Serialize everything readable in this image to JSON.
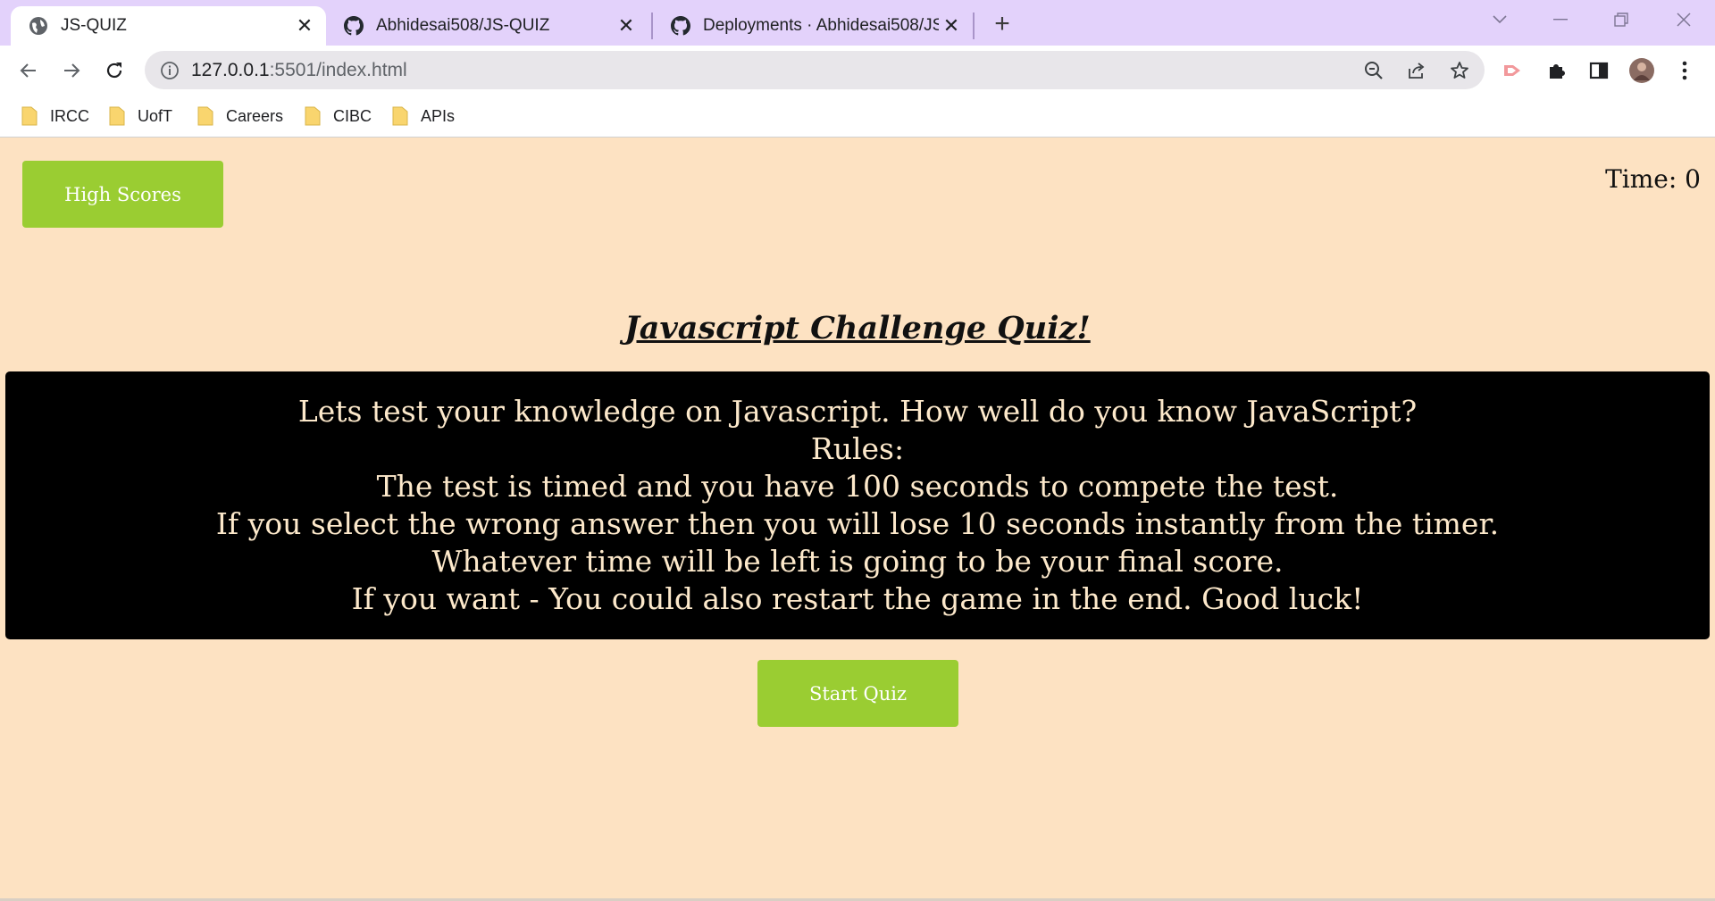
{
  "browser": {
    "tabs": [
      {
        "title": "JS-QUIZ",
        "active": true,
        "icon": "globe-icon"
      },
      {
        "title": "Abhidesai508/JS-QUIZ",
        "active": false,
        "icon": "github-icon"
      },
      {
        "title": "Deployments · Abhidesai508/JS-QUIZ",
        "active": false,
        "icon": "github-icon"
      }
    ],
    "address": {
      "host": "127.0.0.1",
      "rest": ":5501/index.html"
    },
    "bookmarks": [
      "IRCC",
      "UofT",
      "Careers",
      "CIBC",
      "APIs"
    ],
    "colors": {
      "tabstrip": "#e3d2fb",
      "folder": "#f9d56e"
    }
  },
  "page": {
    "high_scores_label": "High Scores",
    "timer_label": "Time:",
    "timer_value": "0",
    "title": "Javascript Challenge Quiz!",
    "rules_lines": [
      "Lets test your knowledge on Javascript. How well do you know JavaScript?",
      "Rules:",
      "The test is timed and you have 100 seconds to compete the test.",
      "If you select the wrong answer then you will lose 10 seconds instantly from the timer.",
      "Whatever time will be left is going to be your final score.",
      "If you want - You could also restart the game in the end. Good luck!"
    ],
    "start_label": "Start Quiz",
    "colors": {
      "background": "#fde2c2",
      "button": "#9acd32",
      "rules_bg": "#000000",
      "rules_text": "#fde9cb"
    }
  }
}
